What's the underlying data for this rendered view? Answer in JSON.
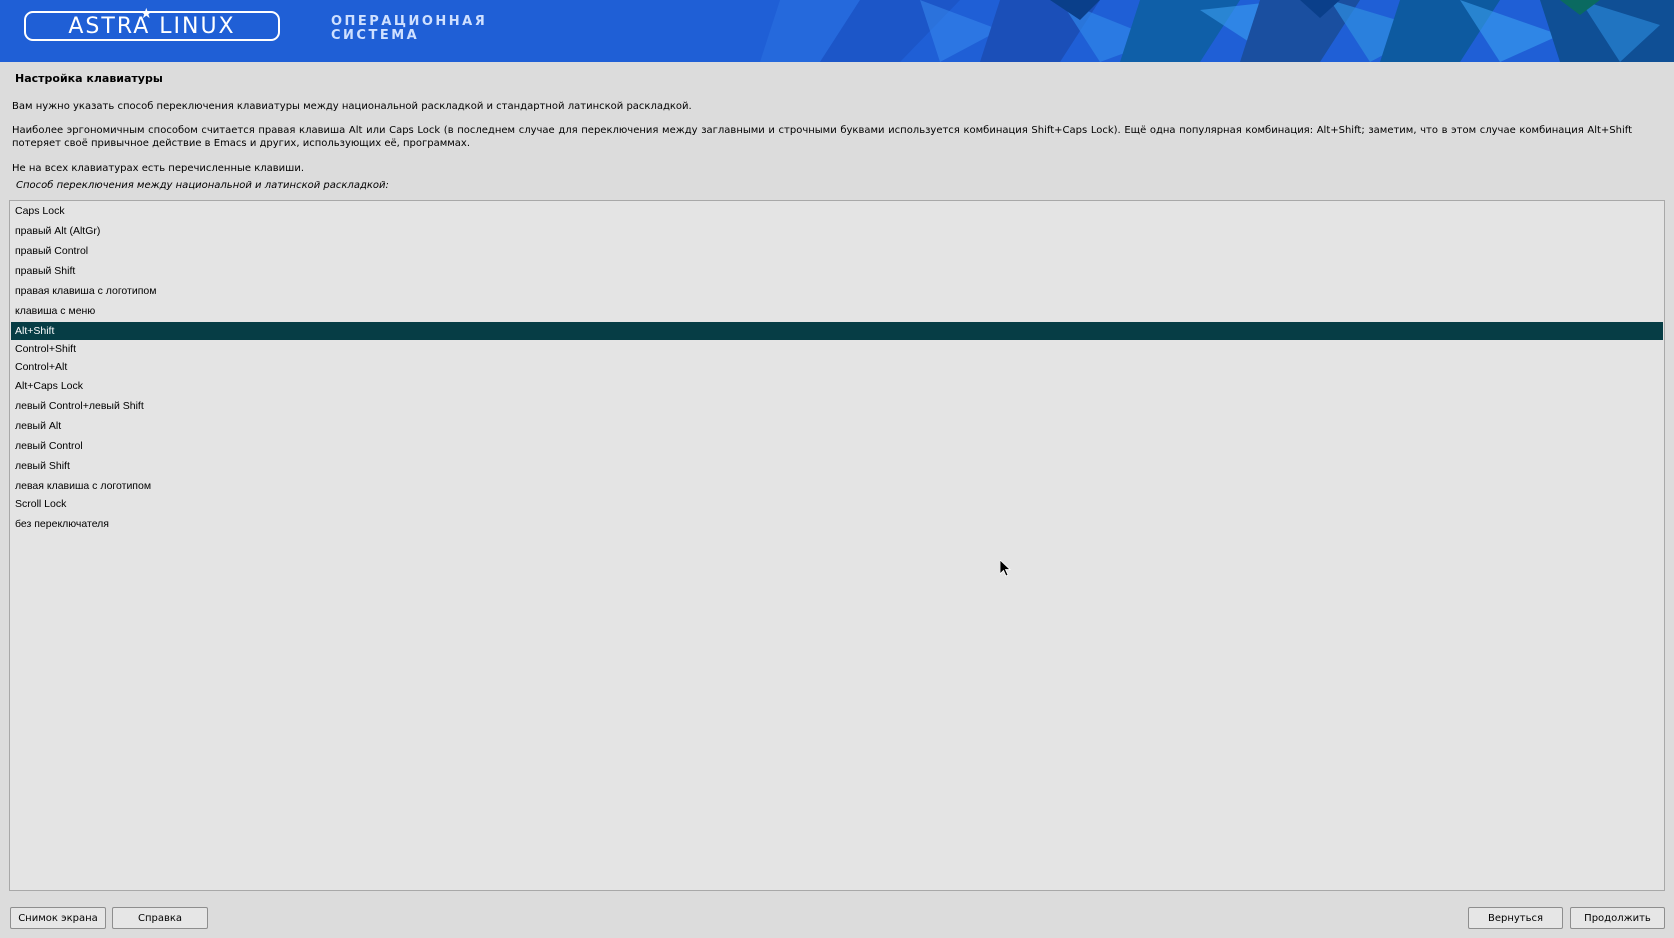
{
  "banner": {
    "logo_text": "ASTRA LINUX",
    "logo_star": "★",
    "subtitle_line1": "ОПЕРАЦИОННАЯ",
    "subtitle_line2": "СИСТЕМА"
  },
  "heading": "Настройка клавиатуры",
  "paragraphs": {
    "p1": "Вам нужно указать способ переключения клавиатуры между национальной раскладкой и стандартной латинской раскладкой.",
    "p2": "Наиболее эргономичным способом считается правая клавиша Alt или Caps Lock (в последнем случае для переключения между заглавными и строчными буквами используется комбинация Shift+Caps Lock). Ещё одна популярная комбинация: Alt+Shift; заметим, что в этом случае комбинация Alt+Shift потеряет своё привычное действие в Emacs и других, использующих её, программах.",
    "p3": "Не на всех клавиатурах есть перечисленные клавиши."
  },
  "question": "Способ переключения между национальной и латинской раскладкой:",
  "options": [
    "Caps Lock",
    "правый Alt (AltGr)",
    "правый Control",
    "правый Shift",
    "правая клавиша с логотипом",
    "клавиша с меню",
    "Alt+Shift",
    "Control+Shift",
    "Control+Alt",
    "Alt+Caps Lock",
    "левый Control+левый Shift",
    "левый Alt",
    "левый Control",
    "левый Shift",
    "левая клавиша с логотипом",
    "Scroll Lock",
    "без переключателя"
  ],
  "selected_option": "Alt+Shift",
  "buttons": {
    "screenshot": "Снимок экрана",
    "help": "Справка",
    "back": "Вернуться",
    "continue": "Продолжить"
  },
  "colors": {
    "banner": "#1f5fd6",
    "selection": "#063d45"
  }
}
